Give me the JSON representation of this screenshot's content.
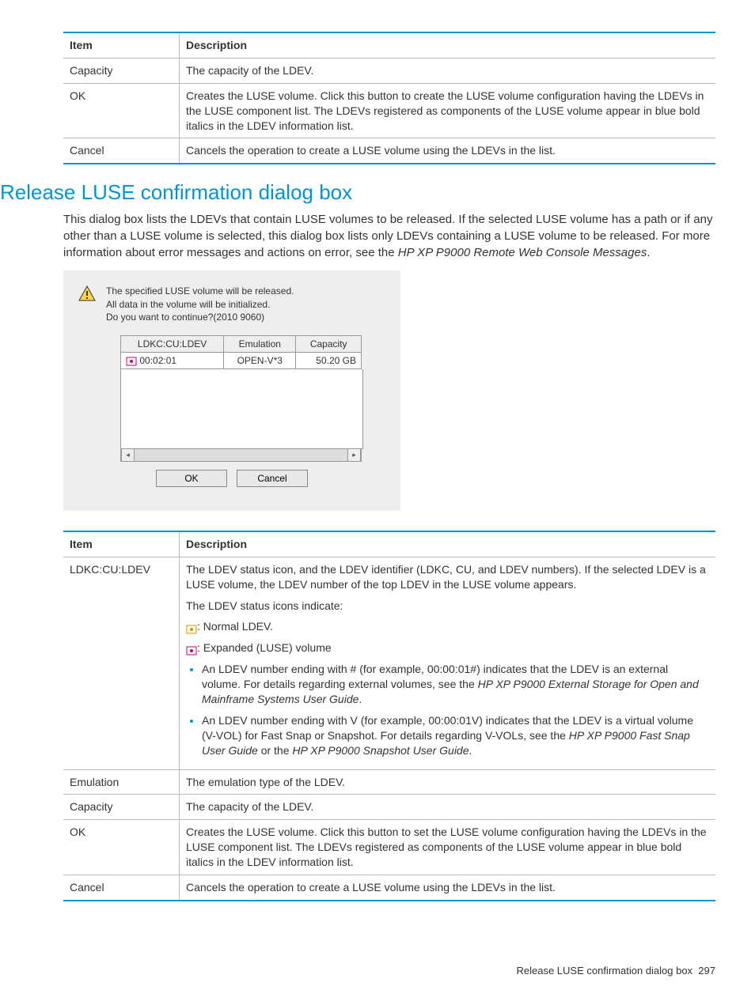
{
  "table1": {
    "headers": [
      "Item",
      "Description"
    ],
    "rows": [
      {
        "item": "Capacity",
        "desc": "The capacity of the LDEV."
      },
      {
        "item": "OK",
        "desc": "Creates the LUSE volume. Click this button to create the LUSE volume configuration having the LDEVs in the LUSE component list. The LDEVs registered as components of the LUSE volume appear in blue bold italics in the LDEV information list."
      },
      {
        "item": "Cancel",
        "desc": "Cancels the operation to create a LUSE volume using the LDEVs in the list."
      }
    ]
  },
  "heading": "Release LUSE confirmation dialog box",
  "intro": {
    "text": "This dialog box lists the LDEVs that contain LUSE volumes to be released. If the selected LUSE volume has a path or if any other than a LUSE volume is selected, this dialog box lists only LDEVs containing a LUSE volume to be released. For more information about error messages and actions on error, see the ",
    "ref": "HP XP P9000 Remote Web Console Messages",
    "after": "."
  },
  "dialog": {
    "msg_line1": "The specified LUSE volume will be released.",
    "msg_line2": "All data in the volume will be initialized.",
    "msg_line3": "Do you want to continue?(2010 9060)",
    "headers": [
      "LDKC:CU:LDEV",
      "Emulation",
      "Capacity"
    ],
    "row": {
      "ldev": "00:02:01",
      "emulation": "OPEN-V*3",
      "capacity": "50.20 GB"
    },
    "ok": "OK",
    "cancel": "Cancel"
  },
  "table2": {
    "headers": [
      "Item",
      "Description"
    ],
    "rows": {
      "ldev": {
        "item": "LDKC:CU:LDEV",
        "p1": "The LDEV status icon, and the LDEV identifier (LDKC, CU, and LDEV numbers). If the selected LDEV is a LUSE volume, the LDEV number of the top LDEV in the LUSE volume appears.",
        "p2": "The LDEV status icons indicate:",
        "icon1_label": ": Normal LDEV.",
        "icon2_label": ": Expanded (LUSE) volume",
        "bullet1a": "An LDEV number ending with # (for example, 00:00:01#) indicates that the LDEV is an external volume. For details regarding external volumes, see the ",
        "bullet1_ref": "HP XP P9000 External Storage for Open and Mainframe Systems User Guide",
        "bullet1b": ".",
        "bullet2a": "An LDEV number ending with V (for example, 00:00:01V) indicates that the LDEV is a virtual volume (V-VOL) for Fast Snap or Snapshot. For details regarding V-VOLs, see the ",
        "bullet2_ref1": "HP XP P9000 Fast Snap User Guide",
        "bullet2_mid": " or the ",
        "bullet2_ref2": "HP XP P9000 Snapshot User Guide",
        "bullet2b": "."
      },
      "emulation": {
        "item": "Emulation",
        "desc": "The emulation type of the LDEV."
      },
      "capacity": {
        "item": "Capacity",
        "desc": "The capacity of the LDEV."
      },
      "ok": {
        "item": "OK",
        "desc": "Creates the LUSE volume. Click this button to set the LUSE volume configuration having the LDEVs in the LUSE component list. The LDEVs registered as components of the LUSE volume appear in blue bold italics in the LDEV information list."
      },
      "cancel": {
        "item": "Cancel",
        "desc": "Cancels the operation to create a LUSE volume using the LDEVs in the list."
      }
    }
  },
  "footer": {
    "text": "Release LUSE confirmation dialog box",
    "page": "297"
  }
}
